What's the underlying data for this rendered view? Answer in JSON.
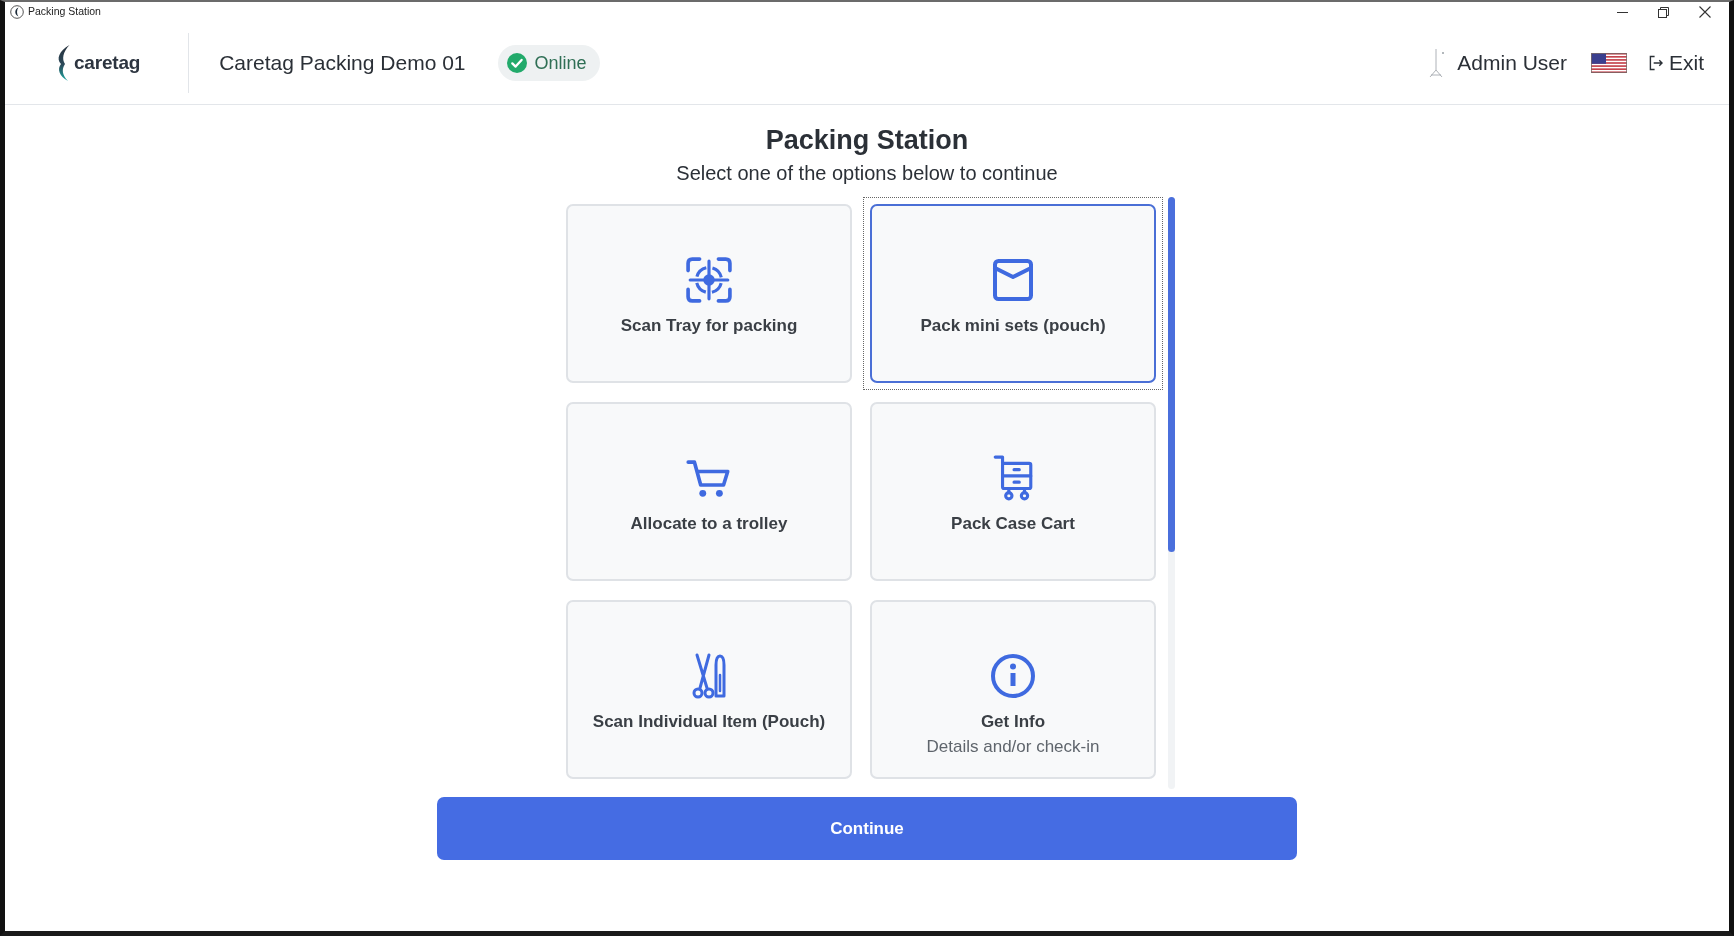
{
  "window": {
    "title": "Packing Station"
  },
  "header": {
    "logo_text": "caretag",
    "station": "Caretag Packing Demo 01",
    "status": {
      "label": "Online",
      "connected": true
    },
    "user": "Admin User",
    "exit": "Exit"
  },
  "main": {
    "title": "Packing Station",
    "subtitle": "Select one of the options below to continue",
    "options": [
      {
        "kind": "scan",
        "label": "Scan Tray for packing",
        "selected": false
      },
      {
        "kind": "pouch",
        "label": "Pack mini sets (pouch)",
        "selected": true
      },
      {
        "kind": "trolley",
        "label": "Allocate to a trolley",
        "selected": false
      },
      {
        "kind": "case-cart",
        "label": "Pack Case Cart",
        "selected": false
      },
      {
        "kind": "instruments",
        "label": "Scan Individual Item (Pouch)",
        "selected": false
      },
      {
        "kind": "info",
        "label": "Get Info",
        "description": "Details and/or check-in",
        "selected": false
      }
    ],
    "continue_button": "Continue"
  }
}
